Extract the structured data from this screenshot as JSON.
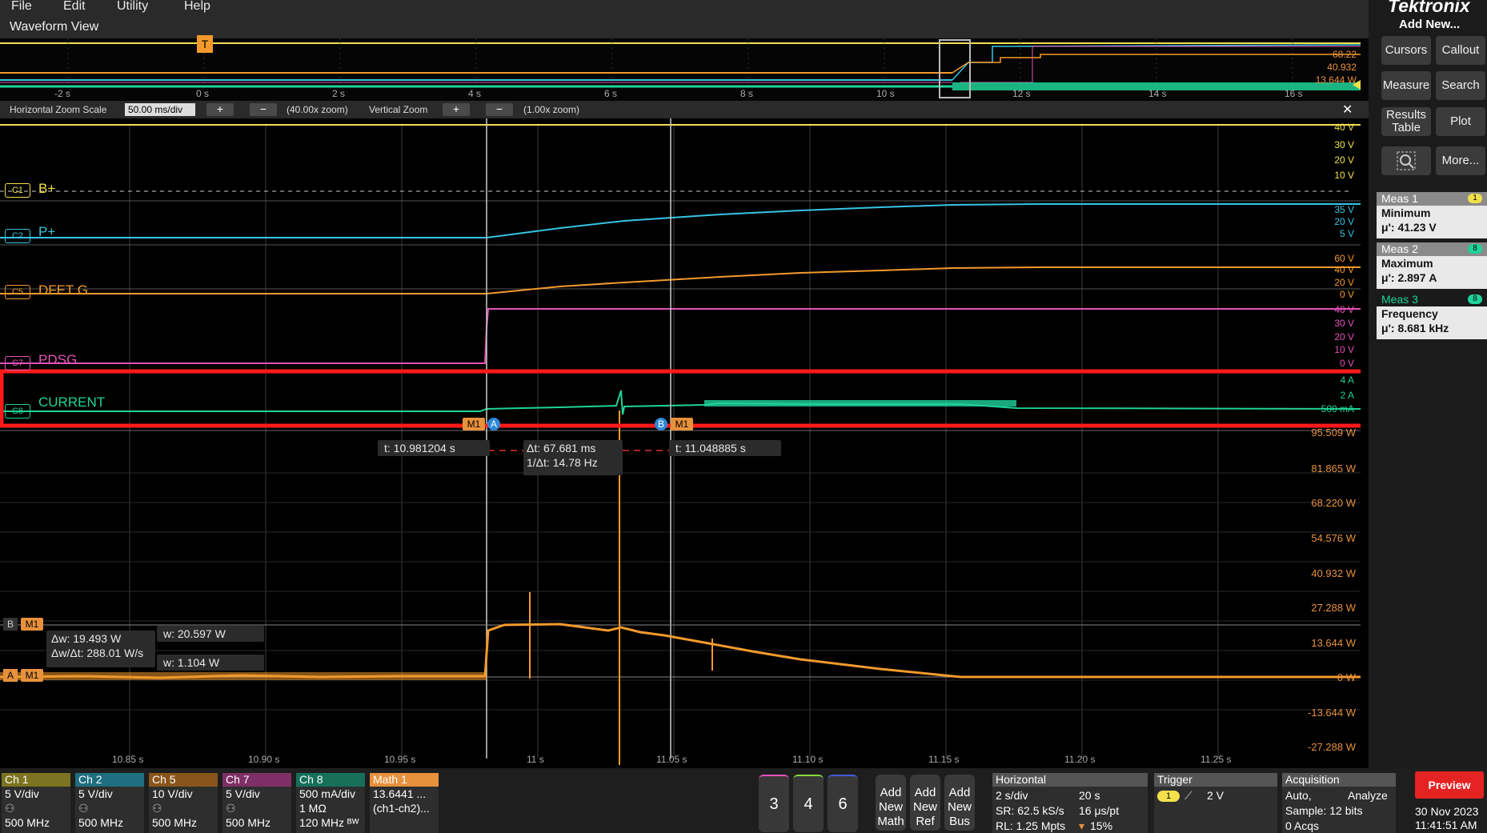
{
  "menu": {
    "items": [
      "File",
      "Edit",
      "Utility",
      "Help"
    ]
  },
  "brand": "Tektronix",
  "waveform_view": {
    "title": "Waveform View",
    "overview": {
      "ticks": [
        "-2 s",
        "0 s",
        "2 s",
        "4 s",
        "6 s",
        "8 s",
        "10 s",
        "12 s",
        "14 s",
        "16 s"
      ],
      "right_values": [
        "68.22",
        "40.932",
        "13.644 W"
      ],
      "trigger_marker": "T"
    },
    "zoom_bar": {
      "horizontal_label": "Horizontal Zoom Scale",
      "horizontal_value": "50.00 ms/div",
      "plus": "+",
      "minus": "−",
      "horizontal_zoom": "(40.00x zoom)",
      "vertical_label": "Vertical Zoom",
      "vertical_zoom": "(1.00x zoom)",
      "close": "✕"
    }
  },
  "channels": [
    {
      "tag": "C1",
      "name": "B+",
      "color": "#f2e14b",
      "scale": [
        "40 V",
        "30 V",
        "20 V",
        "10 V"
      ]
    },
    {
      "tag": "C2",
      "name": "P+",
      "color": "#36c5e3",
      "scale": [
        "35 V",
        "20 V",
        "5 V"
      ]
    },
    {
      "tag": "C5",
      "name": "DFET G",
      "color": "#f39a2c",
      "scale": [
        "60 V",
        "40 V",
        "20 V",
        "0 V"
      ]
    },
    {
      "tag": "C7",
      "name": "PDSG",
      "color": "#e552b8",
      "scale": [
        "40 V",
        "30 V",
        "20 V",
        "10 V",
        "0 V"
      ]
    },
    {
      "tag": "C8",
      "name": "CURRENT",
      "color": "#1fd39a",
      "scale": [
        "4 A",
        "2 A",
        "500 mA"
      ]
    }
  ],
  "markers": {
    "m1": "M1",
    "a": "A",
    "b": "B"
  },
  "cursor_readouts": {
    "t_a": "t: 10.981204 s",
    "dt": "Δt: 67.681 ms",
    "inv_dt": "1/Δt: 14.78 Hz",
    "t_b": "t: 11.048885 s",
    "dw": "Δw: 19.493 W",
    "dw_dt": "Δw/Δt: 288.01 W/s",
    "w_b": "w: 20.597 W",
    "w_a": "w: 1.104 W"
  },
  "math_axis": {
    "labels": [
      "95.509 W",
      "81.865 W",
      "68.220 W",
      "54.576 W",
      "40.932 W",
      "27.288 W",
      "13.644 W",
      "0 W",
      "-13.644 W",
      "-27.288 W"
    ]
  },
  "time_axis": {
    "labels": [
      "10.85 s",
      "10.90 s",
      "10.95 s",
      "11 s",
      "11.05 s",
      "11.10 s",
      "11.15 s",
      "11.20 s",
      "11.25 s"
    ]
  },
  "side_buttons": {
    "add_new": "Add New...",
    "cursors": "Cursors",
    "callout": "Callout",
    "measure": "Measure",
    "search": "Search",
    "results_table": "Results Table",
    "plot": "Plot",
    "more": "More..."
  },
  "measurements": [
    {
      "title": "Meas 1",
      "badge": "1",
      "badge_color": "#f2e14b",
      "type": "Minimum",
      "value": "μ': 41.23 V",
      "header_color": "#7d7d7d"
    },
    {
      "title": "Meas 2",
      "badge": "8",
      "badge_color": "#1fd39a",
      "type": "Maximum",
      "value": "μ': 2.897 A",
      "header_color": "#7d7d7d"
    },
    {
      "title": "Meas 3",
      "badge": "8",
      "badge_color": "#1fd39a",
      "type": "Frequency",
      "value": "μ': 8.681 kHz",
      "header_color": "#1a1a1a"
    }
  ],
  "bottom": {
    "channels": [
      {
        "name": "Ch 1",
        "color": "#7c7420",
        "l1": "5 V/div",
        "l3": "500 MHz"
      },
      {
        "name": "Ch 2",
        "color": "#1f6f80",
        "l1": "5 V/div",
        "l3": "500 MHz"
      },
      {
        "name": "Ch 5",
        "color": "#8a551a",
        "l1": "10 V/div",
        "l3": "500 MHz"
      },
      {
        "name": "Ch 7",
        "color": "#7d2f66",
        "l1": "5 V/div",
        "l3": "500 MHz"
      },
      {
        "name": "Ch 8",
        "color": "#17705a",
        "l1": "500 mA/div",
        "l2": "1 MΩ",
        "l3": "120 MHz ᴮᵂ"
      }
    ],
    "math": {
      "name": "Math 1",
      "l1": "13.6441 ...",
      "l2": "(ch1-ch2)..."
    },
    "num_buttons": [
      "3",
      "4",
      "6"
    ],
    "add_buttons": [
      [
        "Add",
        "New",
        "Math"
      ],
      [
        "Add",
        "New",
        "Ref"
      ],
      [
        "Add",
        "New",
        "Bus"
      ]
    ],
    "horizontal": {
      "title": "Horizontal",
      "scale": "2 s/div",
      "dur": "20 s",
      "sr": "SR: 62.5 kS/s",
      "pt": "16 μs/pt",
      "rl": "RL: 1.25 Mpts",
      "pct": "15%"
    },
    "trigger": {
      "title": "Trigger",
      "src": "1",
      "level": "2 V"
    },
    "acquisition": {
      "title": "Acquisition",
      "mode": "Auto,",
      "analyze": "Analyze",
      "sample": "Sample: 12 bits",
      "acqs": "0 Acqs"
    },
    "preview": "Preview",
    "date": "30 Nov 2023",
    "time": "11:41:51 AM"
  }
}
